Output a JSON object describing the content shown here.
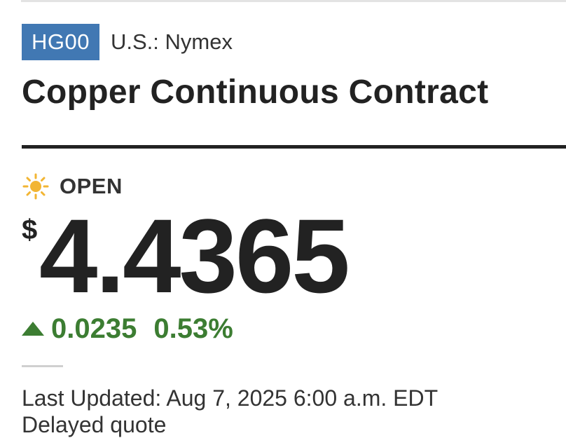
{
  "quote": {
    "ticker": "HG00",
    "exchange": "U.S.: Nymex",
    "title": "Copper Continuous Contract",
    "status": {
      "label": "OPEN",
      "icon": "sun-icon",
      "icon_color": "#f2b533"
    },
    "currency_symbol": "$",
    "price": "4.4365",
    "change": {
      "direction": "up",
      "icon": "up-arrow-icon",
      "value": "0.0235",
      "percent": "0.53%",
      "color": "#3c7d32"
    },
    "last_updated": "Last Updated: Aug 7, 2025 6:00 a.m. EDT",
    "delayed_note": "Delayed quote"
  },
  "colors": {
    "badge_bg": "#4178b3",
    "text": "#222222",
    "positive": "#3c7d32"
  }
}
